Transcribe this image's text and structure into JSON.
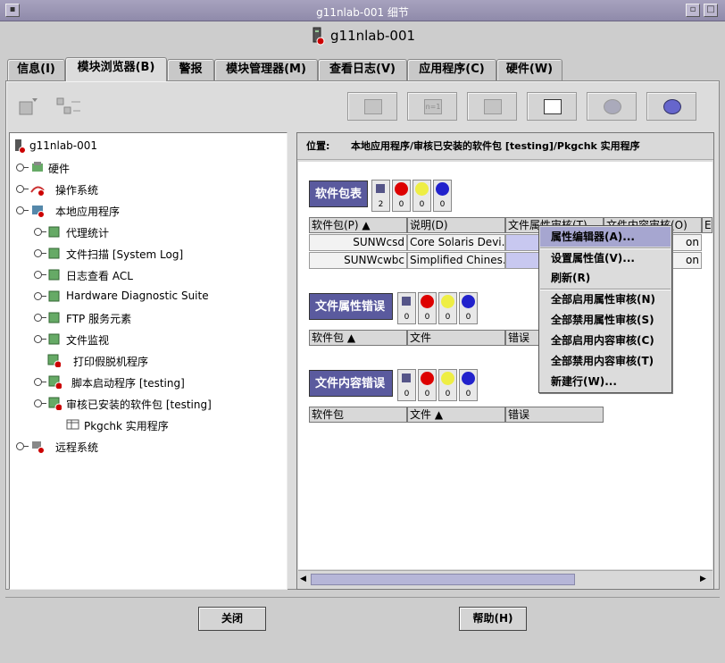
{
  "window": {
    "title": "g11nlab-001 细节",
    "host": "g11nlab-001"
  },
  "tabs": [
    "信息(I)",
    "模块浏览器(B)",
    "警报",
    "模块管理器(M)",
    "查看日志(V)",
    "应用程序(C)",
    "硬件(W)"
  ],
  "toolbar": {
    "n_label": "n=1"
  },
  "tree": {
    "root": "g11nlab-001",
    "items": [
      "硬件",
      "操作系统",
      "本地应用程序",
      "代理统计",
      "文件扫描 [System Log]",
      "日志查看 ACL",
      "Hardware Diagnostic Suite",
      "FTP 服务元素",
      "文件监视",
      "打印假脱机程序",
      "脚本启动程序 [testing]",
      "审核已安装的软件包 [testing]",
      "Pkgchk 实用程序",
      "远程系统"
    ]
  },
  "location": {
    "label": "位置:",
    "path": "本地应用程序/审核已安装的软件包 [testing]/Pkgchk 实用程序"
  },
  "sections": {
    "packages": {
      "title": "软件包表",
      "counts": [
        "2",
        "0",
        "0",
        "0"
      ],
      "headers": [
        "软件包(P) ▲",
        "说明(D)",
        "文件属性审核(T)",
        "文件内容审核(O)",
        "E"
      ],
      "rows": [
        [
          "SUNWcsd",
          "Core Solaris Devi...",
          "on"
        ],
        [
          "SUNWcwbc",
          "Simplified Chines...",
          "on"
        ]
      ]
    },
    "attr": {
      "title": "文件属性错误",
      "counts": [
        "0",
        "0",
        "0",
        "0"
      ],
      "headers": [
        "软件包 ▲",
        "文件",
        "错误"
      ]
    },
    "content": {
      "title": "文件内容错误",
      "counts": [
        "0",
        "0",
        "0",
        "0"
      ],
      "headers": [
        "软件包",
        "文件 ▲",
        "错误"
      ]
    }
  },
  "context_menu": [
    "属性编辑器(A)...",
    "设置属性值(V)...",
    "刷新(R)",
    "全部启用属性审核(N)",
    "全部禁用属性审核(S)",
    "全部启用内容审核(C)",
    "全部禁用内容审核(T)",
    "新建行(W)..."
  ],
  "buttons": {
    "close": "关闭",
    "help": "帮助(H)"
  },
  "colors": {
    "titlebar": "#9a95b4",
    "section": "#5a5a9e",
    "menu_highlight": "#a6a6d0",
    "error_badge": "#cc0000"
  }
}
